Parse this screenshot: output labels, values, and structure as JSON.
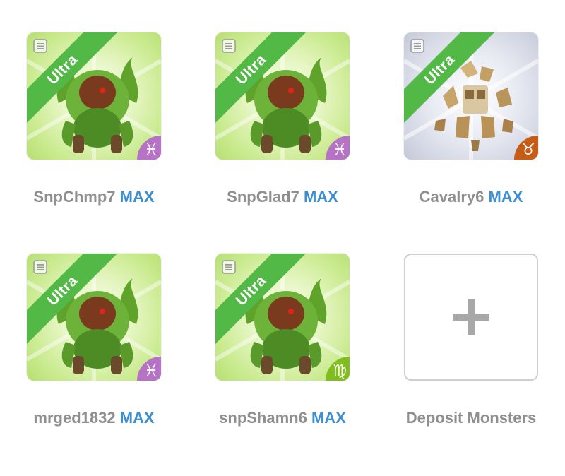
{
  "tier_label": "Ultra",
  "max_label": "MAX",
  "colors": {
    "ribbon": "#52b947",
    "max_text": "#3d8fd0",
    "name_text": "#8f8f8f",
    "pisces": "#b672c4",
    "taurus": "#c65c16",
    "virgo": "#7fbe1e"
  },
  "monsters": [
    {
      "name": "SnpChmp7",
      "tier": "Ultra",
      "level": "MAX",
      "element": "nature",
      "zodiac": "pisces",
      "zodiac_glyph": "♓"
    },
    {
      "name": "SnpGlad7",
      "tier": "Ultra",
      "level": "MAX",
      "element": "nature",
      "zodiac": "pisces",
      "zodiac_glyph": "♓"
    },
    {
      "name": "Cavalry6",
      "tier": "Ultra",
      "level": "MAX",
      "element": "earth",
      "zodiac": "taurus",
      "zodiac_glyph": "♉"
    },
    {
      "name": "mrged1832",
      "tier": "Ultra",
      "level": "MAX",
      "element": "nature",
      "zodiac": "pisces",
      "zodiac_glyph": "♓"
    },
    {
      "name": "snpShamn6",
      "tier": "Ultra",
      "level": "MAX",
      "element": "nature",
      "zodiac": "virgo",
      "zodiac_glyph": "♍"
    }
  ],
  "deposit": {
    "label": "Deposit Monsters",
    "icon": "plus-icon"
  }
}
